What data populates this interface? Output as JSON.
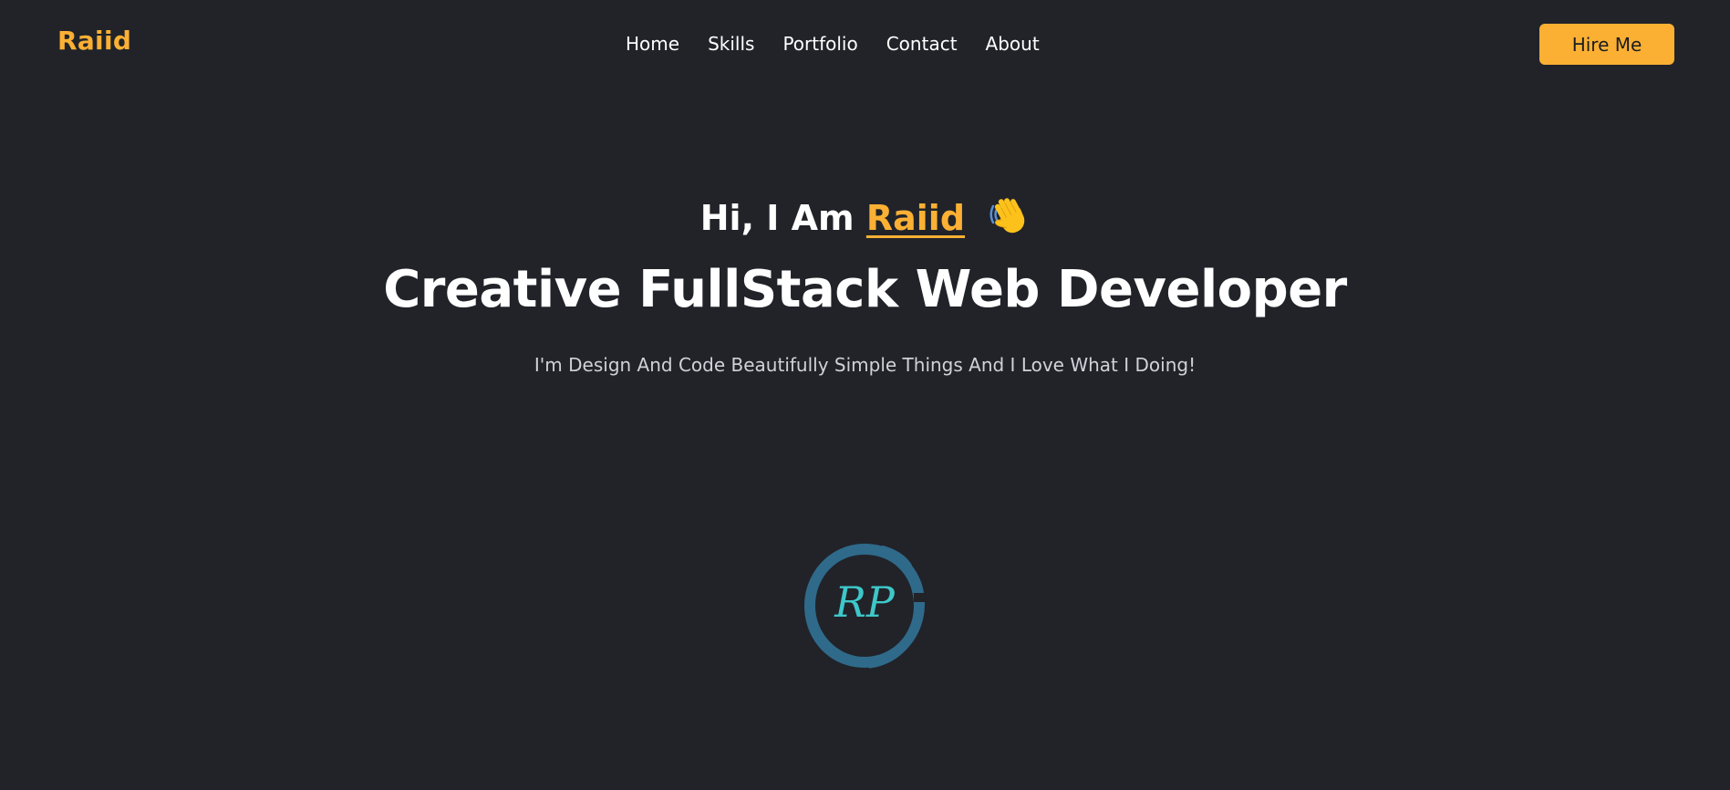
{
  "brand": {
    "logo_text": "Raiid"
  },
  "nav": {
    "items": [
      {
        "label": "Home"
      },
      {
        "label": "Skills"
      },
      {
        "label": "Portfolio"
      },
      {
        "label": "Contact"
      },
      {
        "label": "About"
      }
    ]
  },
  "header": {
    "cta_label": "Hire Me"
  },
  "hero": {
    "greeting_prefix": "Hi, I Am",
    "name": "Raiid",
    "title": "Creative FullStack Web Developer",
    "subtitle": "I'm Design And Code Beautifully Simple Things And I Love What I Doing!"
  },
  "monogram": {
    "text": "RP",
    "icon": "waving-hand-icon"
  },
  "colors": {
    "background": "#212329",
    "accent": "#fbb034",
    "text": "#ffffff",
    "muted_text": "#cfd2d8",
    "monogram_ring": "#2f6a8a",
    "monogram_text": "#3ec7c9"
  }
}
